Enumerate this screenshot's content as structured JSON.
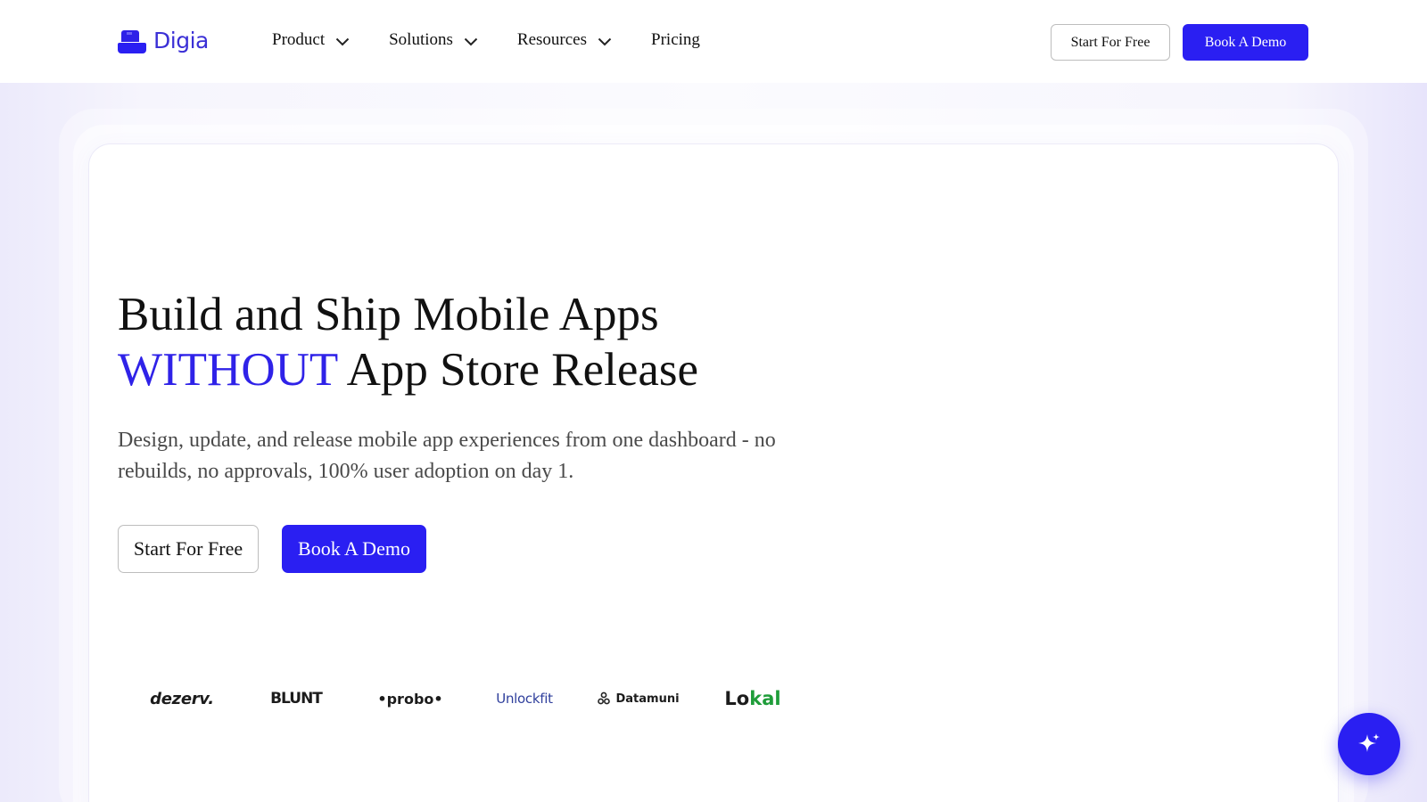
{
  "brand": {
    "name": "Digia",
    "accent_color": "#2a1ff2",
    "logo_icon": "digia-logo-icon"
  },
  "nav": {
    "items": [
      {
        "label": "Product",
        "has_dropdown": true
      },
      {
        "label": "Solutions",
        "has_dropdown": true
      },
      {
        "label": "Resources",
        "has_dropdown": true
      },
      {
        "label": "Pricing",
        "has_dropdown": false
      }
    ],
    "start_free_label": "Start For Free",
    "book_demo_label": "Book A Demo"
  },
  "hero": {
    "title_line1": "Build and Ship Mobile Apps",
    "title_accent": "WITHOUT",
    "title_line2_rest": " App Store Release",
    "subtitle": "Design, update, and release mobile app experiences from one dashboard - no rebuilds, no approvals, 100% user adoption on day 1.",
    "start_free_label": "Start For Free",
    "book_demo_label": "Book A Demo"
  },
  "customer_logos": [
    {
      "name": "dezerv."
    },
    {
      "name": "BLUNT"
    },
    {
      "name": "•probo•"
    },
    {
      "name": "Unlockfit"
    },
    {
      "name": "Datamuni"
    },
    {
      "name_part1": "Lo",
      "name_part2": "kal"
    }
  ],
  "fab": {
    "icon": "sparkle-icon"
  }
}
